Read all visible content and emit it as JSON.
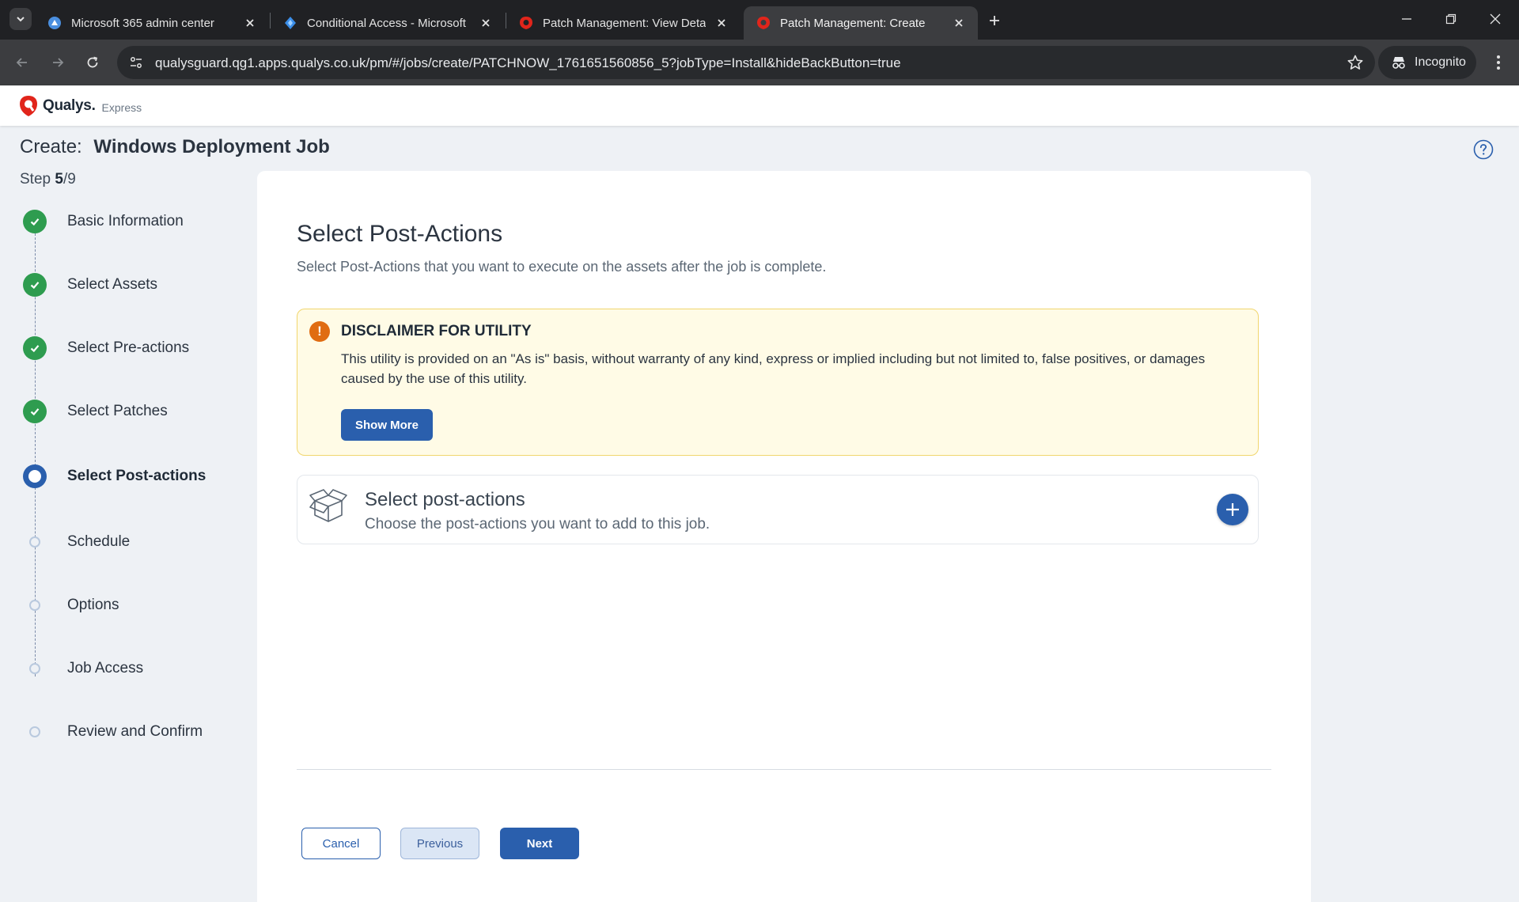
{
  "browser": {
    "tabs": [
      {
        "title": "Microsoft 365 admin center",
        "icon": "m365-admin-icon",
        "active": false
      },
      {
        "title": "Conditional Access - Microsoft E",
        "icon": "entra-icon",
        "active": false
      },
      {
        "title": "Patch Management: View Details",
        "icon": "qualys-icon",
        "active": false
      },
      {
        "title": "Patch Management: Create",
        "icon": "qualys-icon",
        "active": true
      }
    ],
    "url": "qualysguard.qg1.apps.qualys.co.uk/pm/#/jobs/create/PATCHNOW_1761651560856_5?jobType=Install&hideBackButton=true",
    "incognito_label": "Incognito"
  },
  "app": {
    "brand": "Qualys.",
    "edition": "Express",
    "brand_color": "#e1251b"
  },
  "page": {
    "create_label": "Create:",
    "job_name": "Windows Deployment Job",
    "step_prefix": "Step ",
    "step_current": "5",
    "step_total": "/9"
  },
  "steps": [
    {
      "label": "Basic Information",
      "status": "done"
    },
    {
      "label": "Select Assets",
      "status": "done"
    },
    {
      "label": "Select Pre-actions",
      "status": "done"
    },
    {
      "label": "Select Patches",
      "status": "done"
    },
    {
      "label": "Select Post-actions",
      "status": "current"
    },
    {
      "label": "Schedule",
      "status": "pending"
    },
    {
      "label": "Options",
      "status": "pending"
    },
    {
      "label": "Job Access",
      "status": "pending"
    },
    {
      "label": "Review and Confirm",
      "status": "pending"
    }
  ],
  "main": {
    "title": "Select Post-Actions",
    "description": "Select Post-Actions that you want to execute on the assets after the job is complete.",
    "disclaimer": {
      "title": "DISCLAIMER FOR UTILITY",
      "body": "This utility is provided on an \"As is\" basis, without warranty of any kind, express or implied including but not limited to, false positives, or damages caused by the use of this utility.",
      "button": "Show More"
    },
    "post_actions": {
      "title": "Select post-actions",
      "description": "Choose the post-actions you want to add to this job."
    }
  },
  "footer": {
    "cancel": "Cancel",
    "previous": "Previous",
    "next": "Next"
  },
  "colors": {
    "primary": "#2a5fad",
    "done": "#2e9c4f",
    "warning": "#e06c12",
    "disclaimer_bg": "#fffbe6"
  }
}
